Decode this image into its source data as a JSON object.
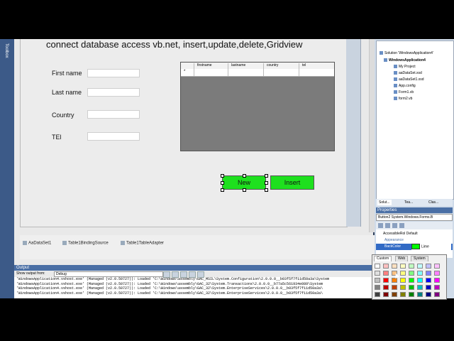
{
  "toolbox": {
    "label": "Toolbox"
  },
  "video_title": "connect database access vb.net, insert,update,delete,Gridview",
  "form": {
    "fields": [
      {
        "label": "First name"
      },
      {
        "label": "Last name"
      },
      {
        "label": "Country"
      },
      {
        "label": "TEl"
      }
    ],
    "grid": {
      "columns": [
        "firstname",
        "lastname",
        "country",
        "tel"
      ],
      "new_row_marker": "*"
    },
    "buttons": {
      "new": "New",
      "insert": "Insert"
    }
  },
  "tray": {
    "items": [
      "AaDataSet1",
      "Table1BindingSource",
      "Table1TableAdapter"
    ]
  },
  "output": {
    "title": "Output",
    "show_from_label": "Show output from:",
    "source": "Debug",
    "lines": [
      "'WindowsApplication4.vshost.exe' (Managed (v2.0.50727)): Loaded 'C:\\Windows\\assembly\\GAC_MSIL\\System.Configuration\\2.0.0.0__b03f5f7f11d50a3a\\System",
      "'WindowsApplication4.vshost.exe' (Managed (v2.0.50727)): Loaded 'C:\\Windows\\assembly\\GAC_32\\System.Transactions\\2.0.0.0__b77a5c561934e089\\System",
      "'WindowsApplication4.vshost.exe' (Managed (v2.0.50727)): Loaded 'C:\\Windows\\assembly\\GAC_32\\System.EnterpriseServices\\2.0.0.0__b03f5f7f11d50a3a\\",
      "'WindowsApplication4.vshost.exe' (Managed (v2.0.50727)): Loaded 'C:\\Windows\\assembly\\GAC_32\\System.EnterpriseServices\\2.0.0.0__b03f5f7f11d50a3a\\"
    ]
  },
  "solution": {
    "solution_name": "Solution 'WindowsApplication4'",
    "project": "WindowsApplication4",
    "items": [
      "My Project",
      "aaDataSet.xsd",
      "aaDataSet1.xsd",
      "App.config",
      "Form1.vb",
      "form2.vb"
    ],
    "tabs": [
      "Solut...",
      "Tea...",
      "Clas..."
    ]
  },
  "properties": {
    "title": "Properties",
    "object": "Button2 System.Windows.Forms.B",
    "rows": {
      "accessible_role": "AccessibleRol Default",
      "appearance": "Appearance",
      "backcolor_name": "BackColor",
      "backcolor_value": "Lime"
    }
  },
  "color_picker": {
    "tabs": [
      "Custom",
      "Web",
      "System"
    ],
    "swatches": [
      "#ffffff",
      "#ffc0c0",
      "#ffe0c0",
      "#ffffc0",
      "#c0ffc0",
      "#c0ffff",
      "#c0c0ff",
      "#ffc0ff",
      "#e0e0e0",
      "#ff8080",
      "#ffc080",
      "#ffff80",
      "#80ff80",
      "#80ffff",
      "#8080ff",
      "#ff80ff",
      "#c0c0c0",
      "#ff0000",
      "#ff8000",
      "#ffff00",
      "#00ff00",
      "#00ffff",
      "#0000ff",
      "#ff00ff",
      "#808080",
      "#c00000",
      "#c04000",
      "#c0c000",
      "#00c000",
      "#00c0c0",
      "#0000c0",
      "#c000c0",
      "#404040",
      "#800000",
      "#804000",
      "#808000",
      "#008000",
      "#008080",
      "#000080",
      "#800080"
    ]
  }
}
